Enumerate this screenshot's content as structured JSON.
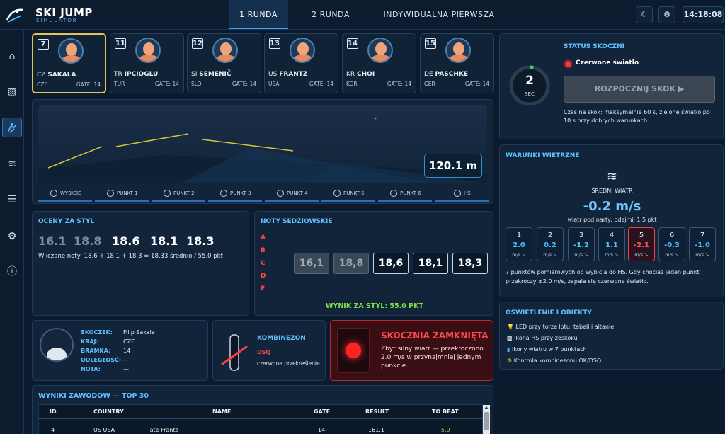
{
  "brand": {
    "name": "SKI JUMP",
    "sub": "SIMULATOR"
  },
  "tabs": [
    {
      "label": "1 RUNDA",
      "active": true
    },
    {
      "label": "2 RUNDA",
      "active": false
    },
    {
      "label": "INDYWIDUALNA PIERWSZA RUNDA",
      "active": false
    }
  ],
  "toolbar": {
    "theme_icon": "☾",
    "settings_icon": "⚙",
    "clock": "14:18:08"
  },
  "sidebar": [
    "home-icon",
    "hill-icon",
    "jumper-icon",
    "wind-icon",
    "list-icon",
    "settings-icon",
    "info-icon"
  ],
  "athletes": [
    {
      "bib": "7",
      "prefix": "CZ",
      "surname": "SAKALA",
      "country": "CZE",
      "gate": "GATE: 14",
      "selected": true
    },
    {
      "bib": "11",
      "prefix": "TR",
      "surname": "IPCIOGLU",
      "country": "TUR",
      "gate": "GATE: 14",
      "selected": false
    },
    {
      "bib": "12",
      "prefix": "SI",
      "surname": "SEMENIČ",
      "country": "SLO",
      "gate": "GATE: 14",
      "selected": false
    },
    {
      "bib": "13",
      "prefix": "US",
      "surname": "FRANTZ",
      "country": "USA",
      "gate": "GATE: 14",
      "selected": false
    },
    {
      "bib": "14",
      "prefix": "KR",
      "surname": "CHOI",
      "country": "KOR",
      "gate": "GATE: 14",
      "selected": false
    },
    {
      "bib": "15",
      "prefix": "DE",
      "surname": "PASCHKE",
      "country": "GER",
      "gate": "GATE: 14",
      "selected": false
    }
  ],
  "jump": {
    "distance": "120.1 m",
    "markers": [
      "WYBICIE",
      "PUNKT 1",
      "PUNKT 2",
      "PUNKT 3",
      "PUNKT 4",
      "PUNKT 5",
      "PUNKT 6",
      "HS"
    ]
  },
  "style": {
    "title": "OCENY ZA STYL",
    "scores": [
      {
        "value": "16.1",
        "counted": false
      },
      {
        "value": "18.8",
        "counted": false
      },
      {
        "value": "18.6",
        "counted": true
      },
      {
        "value": "18.1",
        "counted": true
      },
      {
        "value": "18.3",
        "counted": true
      }
    ],
    "summary": "Wliczane noty: 18.6 + 18.1 + 18.3 = 18.33 średnio / 55.0 pkt"
  },
  "judges": {
    "title": "NOTY SĘDZIOWSKIE",
    "letters": [
      "A",
      "B",
      "C",
      "D",
      "E"
    ],
    "boxes": [
      {
        "text": "16,1",
        "dim": true
      },
      {
        "text": "18,8",
        "dim": true
      },
      {
        "text": "18,6",
        "dim": false
      },
      {
        "text": "18,1",
        "dim": false
      },
      {
        "text": "18,3",
        "dim": false
      }
    ],
    "result": "WYNIK ZA STYL: 55.0 PKT"
  },
  "jumper": {
    "rows": [
      {
        "label": "SKOCZEK:",
        "value": "Filip Sakala"
      },
      {
        "label": "KRAJ:",
        "value": "CZE"
      },
      {
        "label": "BRAMKA:",
        "value": "14"
      },
      {
        "label": "ODLEGŁOŚĆ:",
        "value": "—"
      },
      {
        "label": "NOTA:",
        "value": "—"
      }
    ]
  },
  "suit": {
    "title": "KOMBINEZON",
    "status": "DSQ",
    "desc": "czerwone przekreślenie"
  },
  "closed": {
    "title": "SKOCZNIA ZAMKNIĘTA",
    "desc": "Zbyt silny wiatr — przekroczono 2.0 m/s w przynajmniej jednym punkcie."
  },
  "status": {
    "title": "STATUS SKOCZNI",
    "timer_value": "2",
    "timer_unit": "SEC",
    "timer_fraction": 0.033,
    "light": "Czerwone światło",
    "start_button": "ROZPOCZNIJ SKOK ▶",
    "note": "Czas na skok: maksymalnie 60 s, zielone światło po 10 s przy dobrych warunkach."
  },
  "wind": {
    "title": "WARUNKI WIETRZNE",
    "avg_label": "ŚREDNI WIATR",
    "avg_value": "-0.2 m/s",
    "avg_note": "wiatr pod narty: odejmij 1.5 pkt",
    "points": [
      {
        "n": "1",
        "v": "2.0",
        "bad": false
      },
      {
        "n": "2",
        "v": "0.2",
        "bad": false
      },
      {
        "n": "3",
        "v": "-1.2",
        "bad": false
      },
      {
        "n": "4",
        "v": "1.1",
        "bad": false
      },
      {
        "n": "5",
        "v": "-2.1",
        "bad": true
      },
      {
        "n": "6",
        "v": "-0.3",
        "bad": false
      },
      {
        "n": "7",
        "v": "-1.0",
        "bad": false
      }
    ],
    "unit": "m/s ↘",
    "note": "7 punktów pomiarowych od wybicia do HS. Gdy chociaż jeden punkt przekroczy ±2.0 m/s, zapala się czerwone światło."
  },
  "lighting": {
    "title": "OŚWIETLENIE I OBIEKTY",
    "items": [
      {
        "icon": "💡",
        "text": "LED przy torze lotu, tabeli i altanie"
      },
      {
        "icon": "▩",
        "text": "Ikona HS przy zeskoku"
      },
      {
        "icon": "▮",
        "text": "Ikony wiatru w 7 punktach"
      },
      {
        "icon": "⚙",
        "text": "Kontrola kombinezonu OK/DSQ"
      }
    ]
  },
  "results": {
    "title": "WYNIKI ZAWODÓW — TOP 30",
    "headers": [
      "ID",
      "COUNTRY",
      "NAME",
      "GATE",
      "RESULT",
      "TO BEAT"
    ],
    "rows": [
      [
        "4",
        "US USA",
        "Tate Frantz",
        "14",
        "161.1",
        "-5.0"
      ]
    ]
  }
}
